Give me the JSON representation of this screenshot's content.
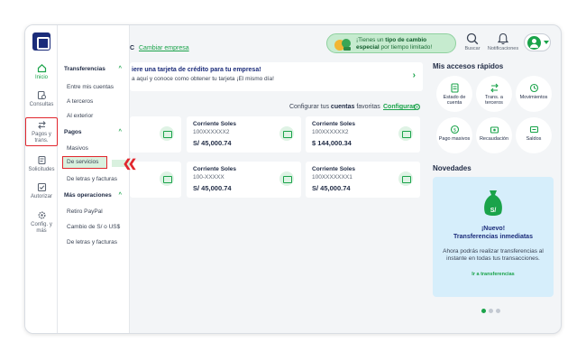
{
  "header": {
    "company_suffix": "C",
    "change_company": "Cambiar empresa",
    "promo_line1_pre": "¡Tienes un ",
    "promo_line1_bold": "tipo de cambio",
    "promo_line2_bold": "especial",
    "promo_line2_post": " por tiempo limitado!",
    "search_label": "Buscar",
    "notifications_label": "Notificaciones"
  },
  "rail": {
    "items": [
      {
        "label": "Inicio",
        "icon": "home-icon"
      },
      {
        "label": "Consultas",
        "icon": "search-doc-icon"
      },
      {
        "label": "Pagos y trans.",
        "icon": "transfer-icon"
      },
      {
        "label": "Solicitudes",
        "icon": "request-icon"
      },
      {
        "label": "Autorizar",
        "icon": "check-icon"
      },
      {
        "label": "Config. y más",
        "icon": "gear-icon"
      }
    ]
  },
  "menu": {
    "transferencias": {
      "title": "Transferencias",
      "items": [
        "Entre mis cuentas",
        "A terceros",
        "Al exterior"
      ]
    },
    "pagos": {
      "title": "Pagos",
      "items": [
        "Masivos",
        "De servicios",
        "De letras y facturas"
      ]
    },
    "mas": {
      "title": "Más operaciones",
      "items": [
        "Retiro PayPal",
        "Cambio de S/ o US$",
        "De letras y facturas"
      ]
    }
  },
  "banner": {
    "title": "iere una tarjeta de crédito para tu empresa!",
    "subtitle": "a aquí y conoce como obtener tu tarjeta ¡El mismo día!"
  },
  "favorites": {
    "label_pre": "Configurar tus ",
    "label_bold": "cuentas",
    "label_post": " favoritas",
    "link": "Configurar"
  },
  "accounts": [
    {
      "title": "",
      "number": "",
      "amount": ""
    },
    {
      "title": "Corriente Soles",
      "number": "100XXXXXX2",
      "amount": "S/ 45,000.74"
    },
    {
      "title": "Corriente Soles",
      "number": "100XXXXXX2",
      "amount": "$ 144,000.34"
    },
    {
      "title": "",
      "number": "",
      "amount": ""
    },
    {
      "title": "Corriente Soles",
      "number": "100-XXXXX",
      "amount": "S/ 45,000.74"
    },
    {
      "title": "Corriente Soles",
      "number": "100XXXXXXX1",
      "amount": "S/ 45,000.74"
    }
  ],
  "quick_access": {
    "title": "Mis accesos rápidos",
    "items": [
      {
        "label": "Estado de cuenta",
        "icon": "statement-icon"
      },
      {
        "label": "Trans. a terceros",
        "icon": "transfer-icon"
      },
      {
        "label": "Movimientos",
        "icon": "movements-icon"
      },
      {
        "label": "Pago masivos",
        "icon": "bulk-pay-icon"
      },
      {
        "label": "Recaudación",
        "icon": "collection-icon"
      },
      {
        "label": "Saldos",
        "icon": "balance-icon"
      }
    ]
  },
  "news": {
    "title": "Novedades",
    "badge": "S/",
    "head1": "¡Nuevo!",
    "head2": "Transferencias inmediatas",
    "body": "Ahora podrás realizar transferencias al instante en todas tus transacciones.",
    "link": "Ir a transferencias"
  },
  "colors": {
    "brand_green": "#1aa34a",
    "brand_navy": "#1b2c7a",
    "highlight_red": "#e1262d"
  }
}
